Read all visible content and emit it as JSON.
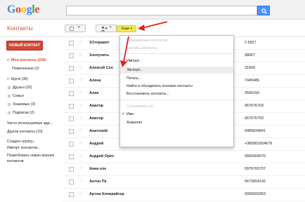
{
  "logo": {
    "g1": "G",
    "o1": "o",
    "o2": "o",
    "g2": "g",
    "l": "l",
    "e": "e"
  },
  "header": {
    "title": "Контакты",
    "more_label": "Еще",
    "more_arrow": "▾",
    "check_arrow": "▾",
    "add_arrow": "▾"
  },
  "sidebar": {
    "new_contact": "НОВЫЙ КОНТАКТ",
    "items": [
      {
        "label": "Мои контакты (230)",
        "selected": true,
        "tri": "▾"
      },
      {
        "label": "Помеченные (2)",
        "selected": false
      },
      {
        "label": "Круги (36)",
        "selected": false,
        "tri": "▾"
      },
      {
        "label": "Друзья (32)",
        "selected": false
      },
      {
        "label": "Семья",
        "selected": false
      },
      {
        "label": "Знакомые (3)",
        "selected": false
      },
      {
        "label": "Подписки (2)",
        "selected": false
      },
      {
        "label": "Часто используемые адр...",
        "selected": false
      },
      {
        "label": "Другие контакты (10)",
        "selected": false
      },
      {
        "label": "Создать группу...",
        "selected": false
      },
      {
        "label": "Импорт контактов...",
        "selected": false
      },
      {
        "label": "Попробовать новую версию",
        "selected": false
      },
      {
        "label": "контактов",
        "selected": false
      }
    ]
  },
  "contacts": [
    {
      "name": "1Отправит",
      "phone": "2 5827"
    },
    {
      "name": "1получить",
      "phone": "98667"
    },
    {
      "name": "Алексей Сео",
      "phone": "31669"
    },
    {
      "name": "Алена",
      "phone": "7445486"
    },
    {
      "name": "Алик",
      "phone": "3595150"
    },
    {
      "name": "Аматор",
      "phone": "067676703"
    },
    {
      "name": "Аматор",
      "phone": "067676703"
    },
    {
      "name": "Анатолий",
      "phone": "0985834841"
    },
    {
      "name": "Андрей",
      "phone": "+380961654679"
    },
    {
      "name": "Андрей Орех",
      "phone": "0666404070"
    },
    {
      "name": "Анна еле",
      "phone": "0976765707"
    },
    {
      "name": "Антон Пк",
      "phone": "0673004142"
    },
    {
      "name": "Артем Копирайтер",
      "phone": "0996583353"
    }
  ],
  "menu": {
    "items": [
      {
        "label": "Объединение контактов",
        "disabled": true
      },
      {
        "label": "Удалить контакты",
        "disabled": true
      },
      {
        "label": "Импорт...",
        "disabled": false
      },
      {
        "label": "Экспорт...",
        "disabled": false,
        "highlight": true
      },
      {
        "label": "Печать...",
        "disabled": false
      },
      {
        "label": "Найти и объединить похожие контакты",
        "disabled": false
      },
      {
        "label": "Восстановить контакты...",
        "disabled": false
      },
      {
        "label": "Сортировать по",
        "disabled": true
      },
      {
        "label": "Имя",
        "disabled": false,
        "checked": true
      },
      {
        "label": "Фамилия",
        "disabled": false
      }
    ],
    "checkmark": "✓"
  },
  "colors": {
    "brand_red": "#dd4b39",
    "search_blue": "#4d90fe",
    "highlight_yellow": "#f0ea53",
    "annotation_red": "#e0201a"
  },
  "icons": {
    "search": "search-icon",
    "add_person": "add-person-icon",
    "star": "star-icon",
    "checkbox": "checkbox-icon"
  }
}
